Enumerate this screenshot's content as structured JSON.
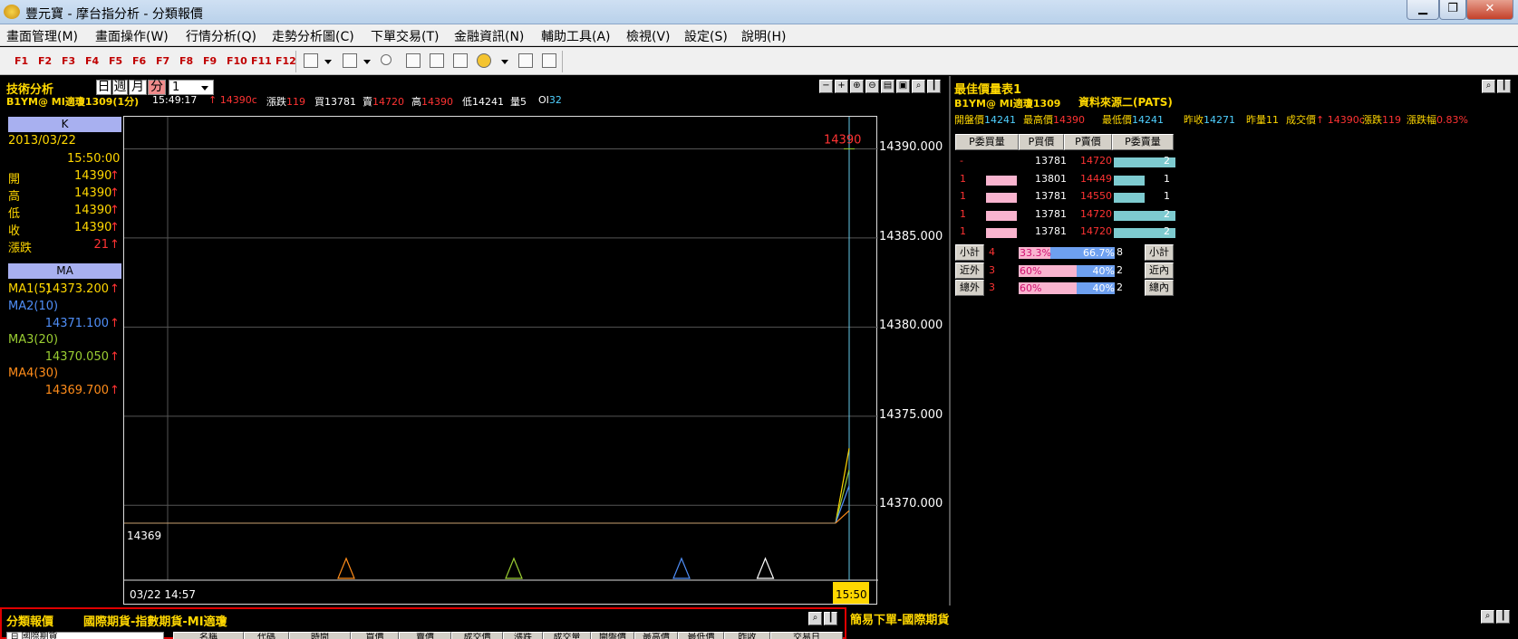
{
  "window": {
    "title": "豐元寶 - 摩台指分析 - 分類報價"
  },
  "menu": [
    "畫面管理(M)",
    "畫面操作(W)",
    "行情分析(Q)",
    "走勢分析圖(C)",
    "下單交易(T)",
    "金融資訊(N)",
    "輔助工具(A)",
    "檢視(V)",
    "設定(S)",
    "說明(H)"
  ],
  "fkeys": [
    "F1",
    "F2",
    "F3",
    "F4",
    "F5",
    "F6",
    "F7",
    "F8",
    "F9",
    "F10",
    "F11",
    "F12"
  ],
  "tech": {
    "title": "技術分析",
    "periods": [
      "日",
      "週",
      "月",
      "分"
    ],
    "active_period": "分",
    "interval": "1",
    "symbol": "B1YM@ MI適瓊1309(1分)",
    "time": "15:49:17",
    "last_price": "↑ 14390c",
    "change": "漲跌119",
    "bid": "買13781",
    "ask": "賣14720",
    "high": "高14390",
    "low": "低14241",
    "volume": "量5",
    "oi": "OI32"
  },
  "kinfo": {
    "header": "K",
    "date": "2013/03/22",
    "time": "15:50:00",
    "rows": [
      {
        "label": "開",
        "value": "14390",
        "arrow": "↑"
      },
      {
        "label": "高",
        "value": "14390",
        "arrow": "↑"
      },
      {
        "label": "低",
        "value": "14390",
        "arrow": "↑"
      },
      {
        "label": "收",
        "value": "14390",
        "arrow": "↑"
      },
      {
        "label": "漲跌",
        "value": "21",
        "arrow": "↑"
      }
    ]
  },
  "ma": {
    "header": "MA",
    "items": [
      {
        "label": "MA1(5)",
        "value": "14373.200",
        "arrow": "↑",
        "color": "#ffd700"
      },
      {
        "label": "MA2(10)",
        "value": "14371.100",
        "arrow": "↑",
        "color": "#4f8ef7"
      },
      {
        "label": "MA3(20)",
        "value": "14370.050",
        "arrow": "↑",
        "color": "#9acd32"
      },
      {
        "label": "MA4(30)",
        "value": "14369.700",
        "arrow": "↑",
        "color": "#ff8c1a"
      }
    ]
  },
  "chart_data": {
    "type": "line",
    "y_ticks": [
      "14390.000",
      "14385.000",
      "14380.000",
      "14375.000",
      "14370.000"
    ],
    "ylim": [
      14365.8,
      14391.8
    ],
    "last_price_label": "14390",
    "low_label": "14369",
    "x_start_label": "03/22 14:57",
    "x_end_label": "15:50",
    "baseline": 14369,
    "markers": [
      {
        "x": 0.25,
        "color": "#ff8c1a"
      },
      {
        "x": 0.5,
        "color": "#9acd32"
      },
      {
        "x": 0.75,
        "color": "#4f8ef7"
      },
      {
        "x": 0.875,
        "color": "#ffffff"
      }
    ],
    "series": [
      {
        "color": "#ffd700",
        "end": 14373.2
      },
      {
        "color": "#9acd32",
        "end": 14372.0
      },
      {
        "color": "#4f8ef7",
        "end": 14371.1
      },
      {
        "color": "#ff8c1a",
        "end": 14369.7
      }
    ]
  },
  "book": {
    "title": "最佳價量表1",
    "symbol": "B1YM@ MI適瓊1309",
    "source": "資料來源二(PATS)",
    "summary": [
      {
        "label": "開盤價",
        "value": "14241"
      },
      {
        "label": "最高價",
        "value": "14390"
      },
      {
        "label": "最低價",
        "value": "14241"
      },
      {
        "label": "昨收",
        "value": "14271"
      },
      {
        "label": "昨量",
        "value": "11"
      },
      {
        "label": "成交價",
        "value": "↑ 14390c"
      },
      {
        "label": "漲跌",
        "value": "119"
      },
      {
        "label": "漲跌幅",
        "value": "0.83%"
      }
    ],
    "headers": [
      "P委買量",
      "P買價",
      "P賣價",
      "P委賣量"
    ],
    "rows": [
      {
        "bidq": "-",
        "bid": "13781",
        "ask": "14720",
        "askq": "2",
        "bidbar": 0,
        "askbar": 1.0
      },
      {
        "bidq": "1",
        "bid": "13801",
        "ask": "14449",
        "askq": "1",
        "bidbar": 1.0,
        "askbar": 0.5
      },
      {
        "bidq": "1",
        "bid": "13781",
        "ask": "14550",
        "askq": "1",
        "bidbar": 1.0,
        "askbar": 0.5
      },
      {
        "bidq": "1",
        "bid": "13781",
        "ask": "14720",
        "askq": "2",
        "bidbar": 1.0,
        "askbar": 1.0
      },
      {
        "bidq": "1",
        "bid": "13781",
        "ask": "14720",
        "askq": "2",
        "bidbar": 1.0,
        "askbar": 1.0
      }
    ],
    "totals": [
      {
        "label": "小計",
        "left": "4",
        "pct_left": "33.3%",
        "pct_right": "66.7%",
        "right": "8",
        "label2": "小計",
        "frac": 0.333
      },
      {
        "label": "近外",
        "left": "3",
        "pct_left": "60%",
        "pct_right": "40%",
        "right": "2",
        "label2": "近內",
        "frac": 0.6
      },
      {
        "label": "總外",
        "left": "3",
        "pct_left": "60%",
        "pct_right": "40%",
        "right": "2",
        "label2": "總內",
        "frac": 0.6
      }
    ]
  },
  "category": {
    "title": "分類報價",
    "path": "國際期貨-指數期貨-MI適瓊",
    "tree_item": "國際期貨",
    "columns": [
      "名稱",
      "代碼",
      "時間",
      "買價",
      "賣價",
      "成交價",
      "漲跌",
      "成交量",
      "開盤價",
      "最高價",
      "最低價",
      "昨收",
      "交易日"
    ]
  },
  "trade": {
    "title": "簡易下單-國際期貨"
  }
}
